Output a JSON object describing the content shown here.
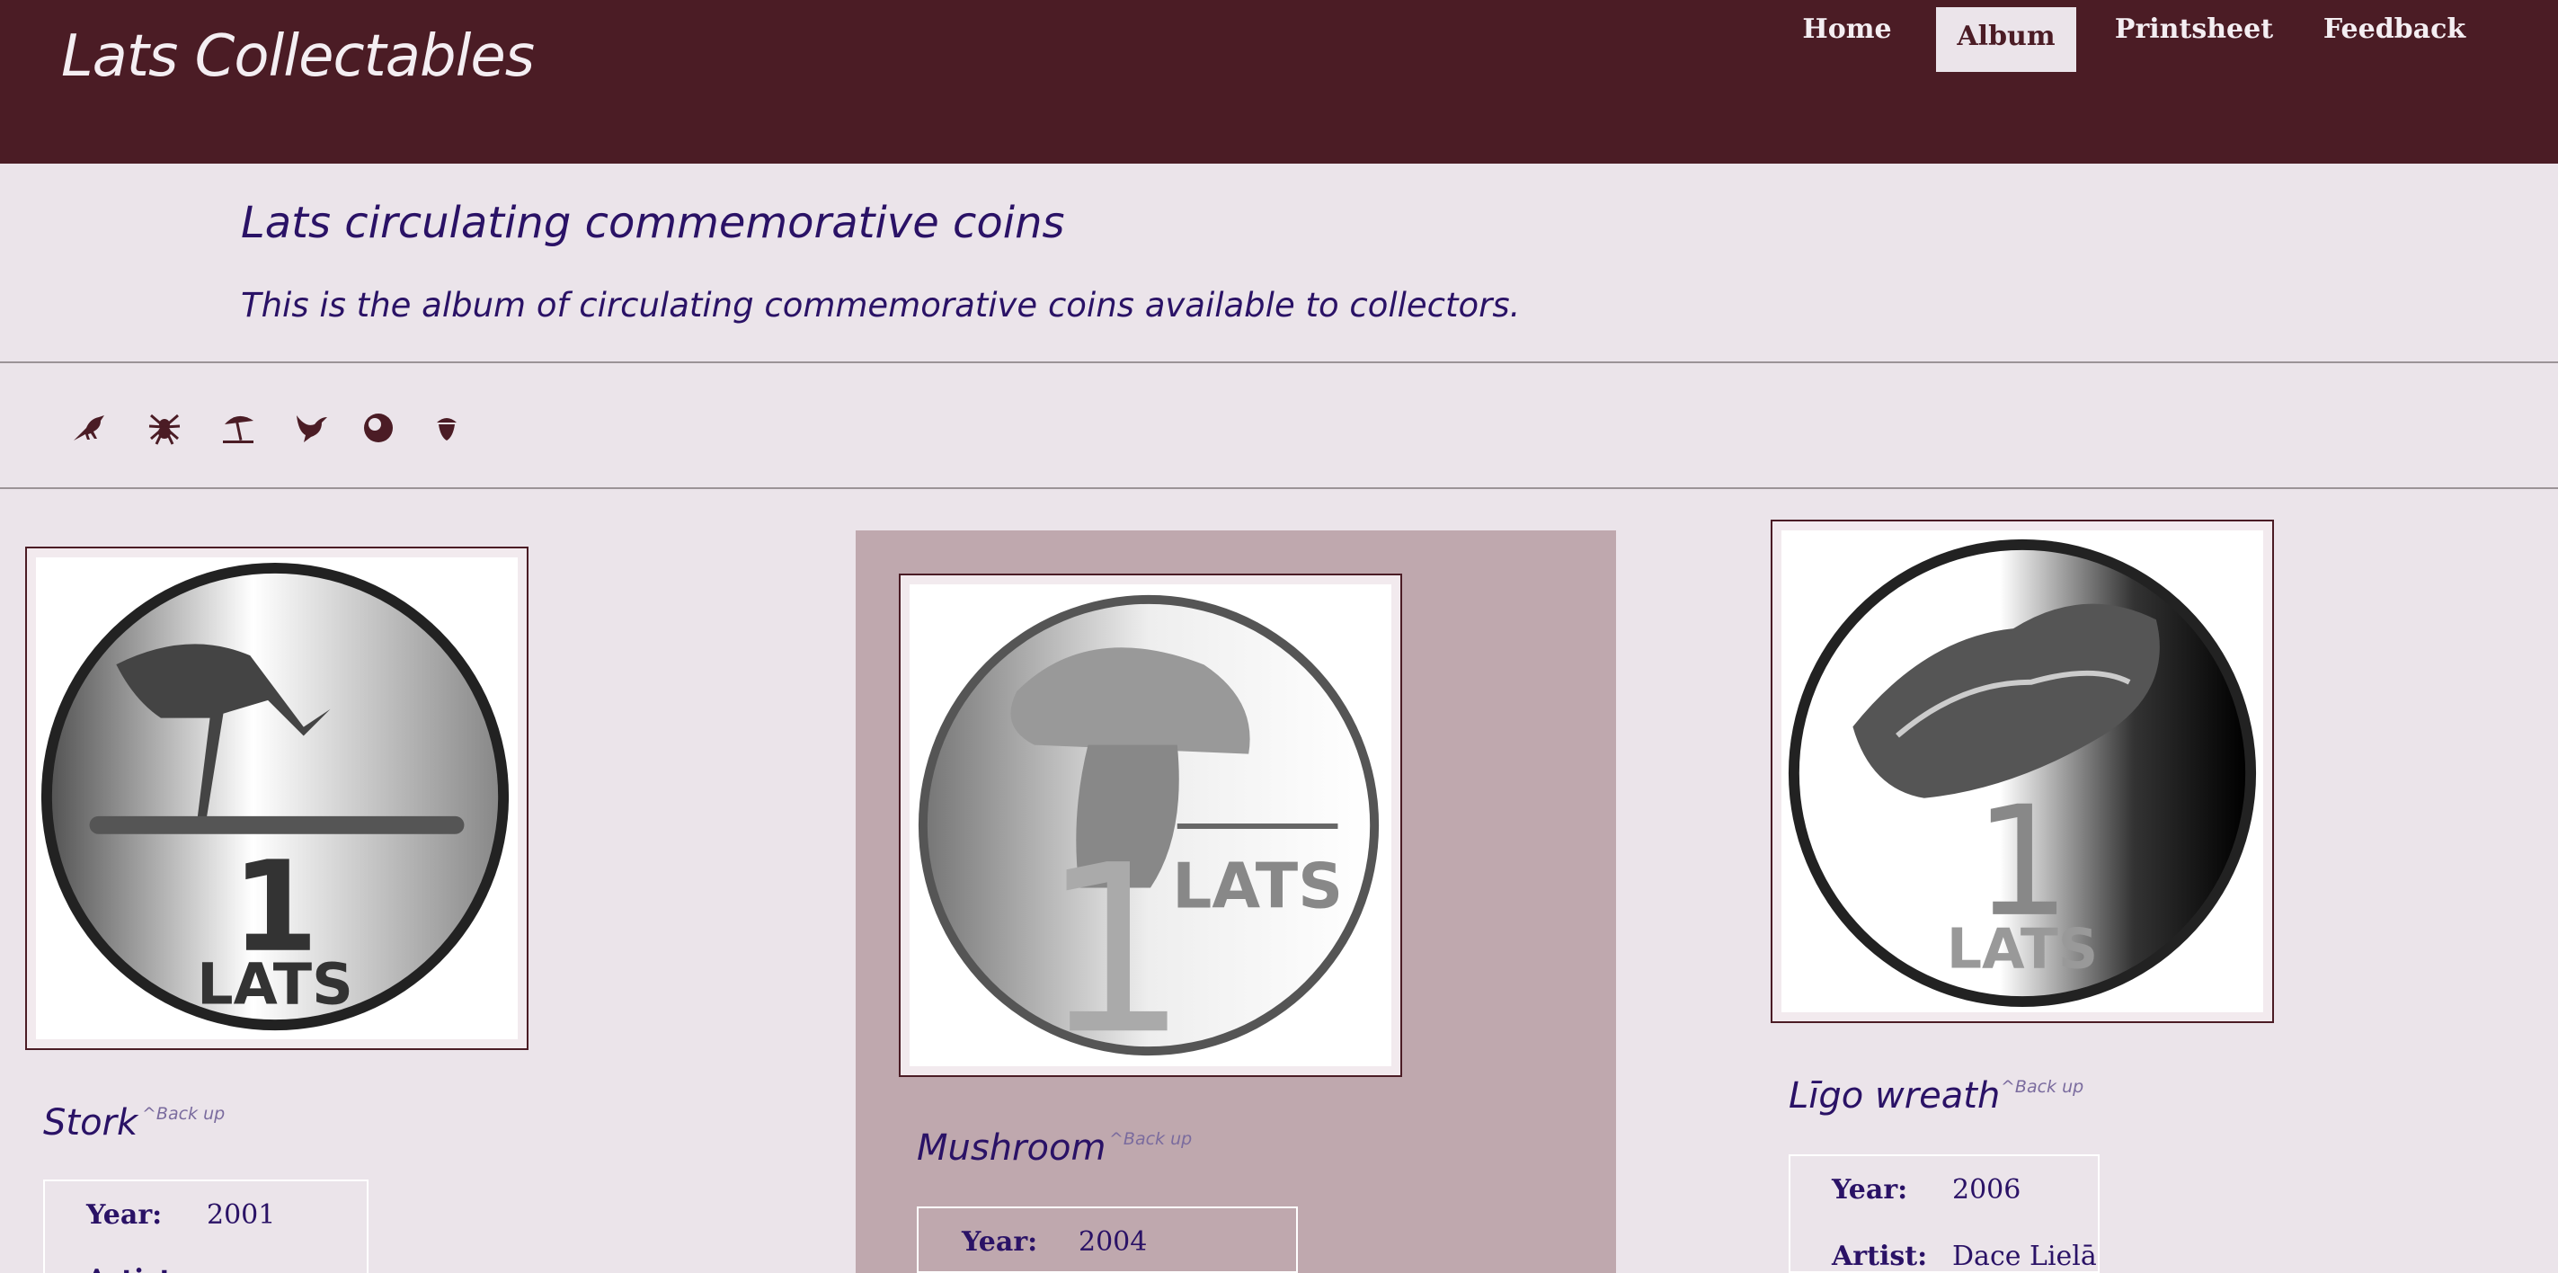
{
  "header": {
    "site_title": "Lats Collectables",
    "nav": [
      {
        "label": "Home",
        "active": false
      },
      {
        "label": "Album",
        "active": true
      },
      {
        "label": "Printsheet",
        "active": false
      },
      {
        "label": "Feedback",
        "active": false
      }
    ]
  },
  "intro": {
    "heading": "Lats circulating commemorative coins",
    "lede": "This is the album of circulating commemorative coins available to collectors."
  },
  "icon_bar": [
    {
      "icon": "bird-icon"
    },
    {
      "icon": "spider-icon"
    },
    {
      "icon": "beach-umbrella-icon"
    },
    {
      "icon": "dove-icon"
    },
    {
      "icon": "yin-circle-icon"
    },
    {
      "icon": "acorn-icon"
    }
  ],
  "coins": [
    {
      "name": "Stork",
      "back_up": "^Back up",
      "year_label": "Year:",
      "year": "2001",
      "artist_label": "Artist:",
      "artist": "",
      "coin_label": "1",
      "coin_text": "LATS"
    },
    {
      "name": "Mushroom",
      "back_up": "^Back up",
      "year_label": "Year:",
      "year": "2004",
      "coin_label": "1",
      "coin_text": "LATS"
    },
    {
      "name": "Līgo wreath",
      "back_up": "^Back up",
      "year_label": "Year:",
      "year": "2006",
      "artist_label": "Artist:",
      "artist": "Dace Lielā",
      "coin_label": "1",
      "coin_text": "LATS"
    }
  ],
  "colors": {
    "header_bg": "#4b1c25",
    "page_bg": "#ebe4ea",
    "heading_text": "#2a1266",
    "highlight_card": "#bfa8ae"
  }
}
